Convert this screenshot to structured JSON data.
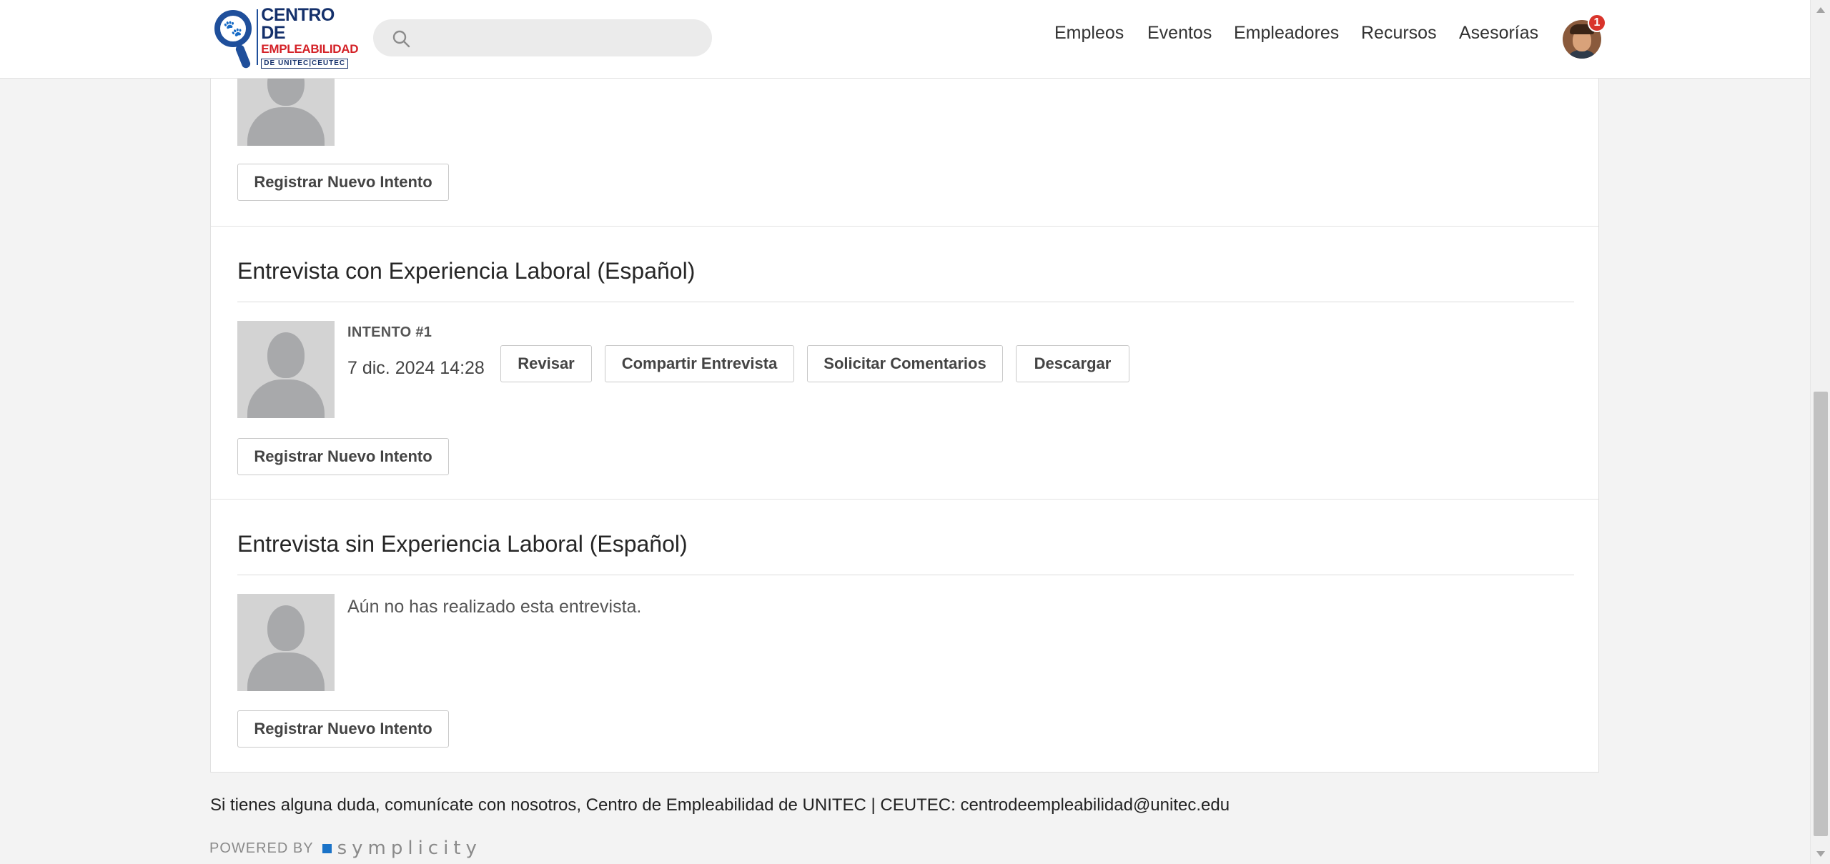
{
  "header": {
    "logo": {
      "line1": "CENTRO DE",
      "line2": "EMPLEABILIDAD",
      "line3": "DE UNITEC|CEUTEC"
    },
    "search": {
      "placeholder": "",
      "value": ""
    },
    "nav": [
      "Empleos",
      "Eventos",
      "Empleadores",
      "Recursos",
      "Asesorías"
    ],
    "notification_count": "1"
  },
  "sections": [
    {
      "title": "",
      "register_button": "Registrar Nuevo Intento"
    },
    {
      "title": "Entrevista con Experiencia Laboral (Español)",
      "attempt": {
        "label": "INTENTO #1",
        "date": "7 dic. 2024 14:28",
        "actions": [
          "Revisar",
          "Compartir Entrevista",
          "Solicitar Comentarios",
          "Descargar"
        ]
      },
      "register_button": "Registrar Nuevo Intento"
    },
    {
      "title": "Entrevista sin Experiencia Laboral (Español)",
      "empty_message": "Aún no has realizado esta entrevista.",
      "register_button": "Registrar Nuevo Intento"
    }
  ],
  "footer": {
    "contact": "Si tienes alguna duda, comunícate con nosotros, Centro de Empleabilidad de UNITEC | CEUTEC: centrodeempleabilidad@unitec.edu",
    "powered_by": "POWERED BY",
    "brand": "symplicity"
  },
  "colors": {
    "brand_blue": "#14306b",
    "brand_red": "#d42127",
    "badge_red": "#d9342b",
    "symplicity_blue": "#1a73c8",
    "page_background": "#f3f3f3"
  }
}
